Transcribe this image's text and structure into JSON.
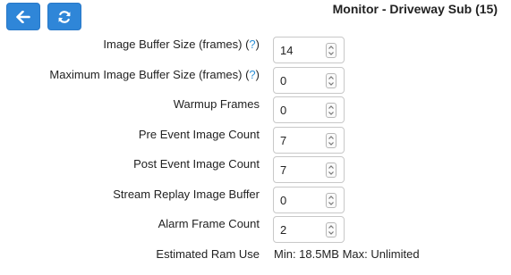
{
  "header": {
    "title": "Monitor - Driveway Sub (15)",
    "back_icon": "arrow-left-icon",
    "refresh_icon": "refresh-icon",
    "accent_color": "#2f86d8"
  },
  "fields": [
    {
      "label": "Image Buffer Size (frames)",
      "help": "?",
      "value": "14"
    },
    {
      "label": "Maximum Image Buffer Size (frames)",
      "help": "?",
      "value": "0"
    },
    {
      "label": "Warmup Frames",
      "value": "0"
    },
    {
      "label": "Pre Event Image Count",
      "value": "7"
    },
    {
      "label": "Post Event Image Count",
      "value": "7"
    },
    {
      "label": "Stream Replay Image Buffer",
      "value": "0"
    },
    {
      "label": "Alarm Frame Count",
      "value": "2"
    }
  ],
  "ram": {
    "label": "Estimated Ram Use",
    "value": "Min: 18.5MB Max: Unlimited"
  }
}
